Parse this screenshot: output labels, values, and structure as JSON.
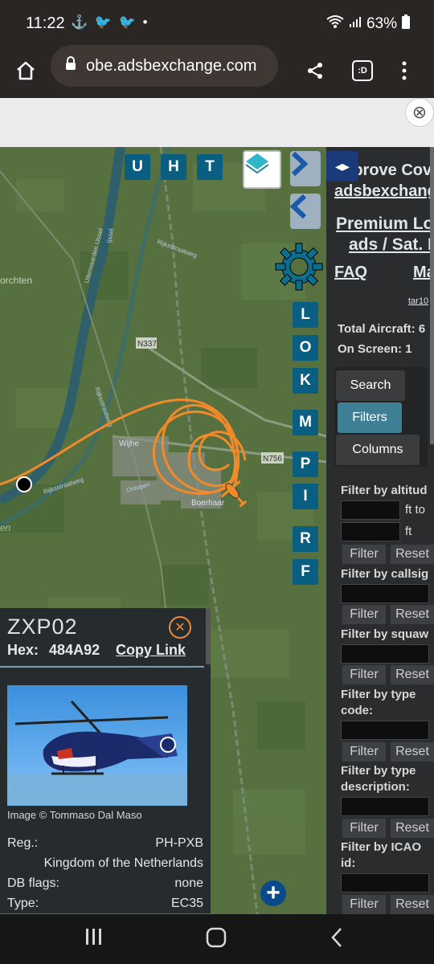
{
  "status": {
    "time": "11:22",
    "notification_icons": "⚓ 🐦 🐦 •",
    "battery": "63%"
  },
  "browser": {
    "url": "obe.adsbexchange.com",
    "tab_count": ":D"
  },
  "map": {
    "buttons_top": [
      "U",
      "H",
      "T"
    ],
    "buttons_side": [
      "L",
      "O",
      "K",
      "M",
      "P",
      "I",
      "R",
      "F"
    ],
    "place_labels": {
      "town_left": "orchten",
      "road1": "N337",
      "road2": "N756",
      "water": "Ijssel",
      "uiterwaarden": "Uiterwaarden IJssel",
      "rijks1": "Rijksstraatweg",
      "rijks2": "Rijksstraatweg",
      "rijks3": "Rijksstraatweg",
      "town_center": "Wijhe",
      "town_b": "Boerhaar",
      "small_en": "en",
      "oldelaan": "Onlopen"
    }
  },
  "aircraft": {
    "callsign": "ZXP02",
    "hex_label": "Hex:",
    "hex": "484A92",
    "copy_link": "Copy Link",
    "photo_credit": "Image © Tommaso Dal Maso",
    "reg_label": "Reg.:",
    "reg": "PH-PXB",
    "country": "Kingdom of the Netherlands",
    "dbflags_label": "DB flags:",
    "dbflags": "none",
    "type_label": "Type:",
    "type": "EC35"
  },
  "sidebar": {
    "improve": "Improve Cov",
    "adsbexchange": "adsbexchang",
    "premium1": "Premium Lo",
    "premium2": "ads / Sat. I",
    "faq": "FAQ",
    "map": "Ma",
    "tar": "tar10",
    "total_aircraft": "Total Aircraft: 6",
    "on_screen": "On Screen: 1",
    "tabs": [
      "Search",
      "Filters",
      "Columns"
    ],
    "filters": [
      {
        "label": "Filter by altitud",
        "inputs": 2,
        "suffixes": [
          "ft to",
          "ft"
        ]
      },
      {
        "label": "Filter by callsig",
        "inputs": 1
      },
      {
        "label": "Filter by squaw",
        "inputs": 1
      },
      {
        "label": "Filter by type code:",
        "inputs": 1
      },
      {
        "label": "Filter by type description:",
        "inputs": 1
      },
      {
        "label": "Filter by ICAO id:",
        "inputs": 1
      }
    ],
    "filter_btn": "Filter",
    "reset_btn": "Reset"
  },
  "colors": {
    "map_bg": "#56713f",
    "track": "#f28a2a",
    "button": "#0a5e82",
    "sidebar": "#2a2c2e",
    "filters_tab": "#3f7f95"
  }
}
